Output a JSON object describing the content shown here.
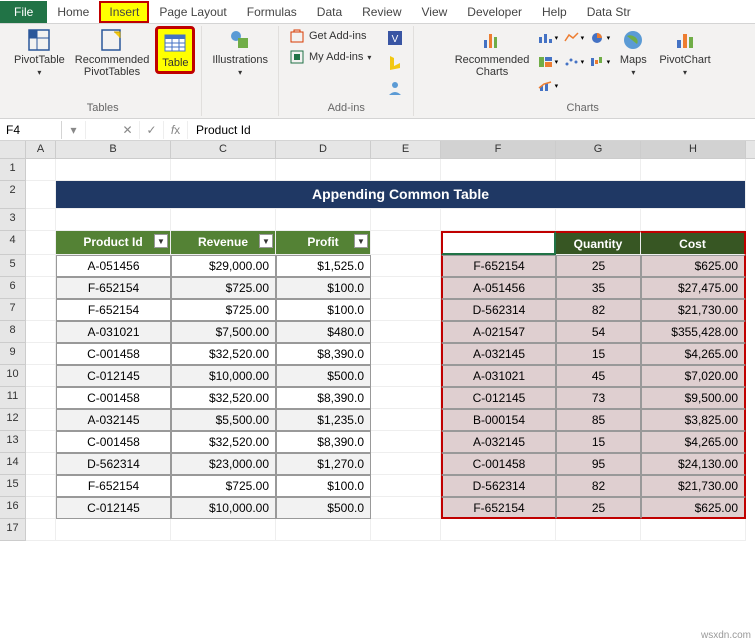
{
  "tabs": {
    "file": "File",
    "home": "Home",
    "insert": "Insert",
    "pagelayout": "Page Layout",
    "formulas": "Formulas",
    "data": "Data",
    "review": "Review",
    "view": "View",
    "developer": "Developer",
    "help": "Help",
    "datastr": "Data Str"
  },
  "ribbon": {
    "tables": {
      "pivottable": "PivotTable",
      "recommended": "Recommended\nPivotTables",
      "table": "Table",
      "group": "Tables"
    },
    "illustrations": {
      "label": "Illustrations",
      "group": ""
    },
    "addins": {
      "getaddins": "Get Add-ins",
      "myaddins": "My Add-ins",
      "group": "Add-ins"
    },
    "charts": {
      "recommended": "Recommended\nCharts",
      "maps": "Maps",
      "pivotchart": "PivotChart",
      "group": "Charts"
    }
  },
  "formula_bar": {
    "name": "F4",
    "value": "Product Id"
  },
  "columns": {
    "A": 30,
    "B": 115,
    "C": 105,
    "D": 95,
    "E": 70,
    "F": 115,
    "G": 85,
    "H": 105
  },
  "title": "Appending Common Table",
  "left_table": {
    "headers": [
      "Product Id",
      "Revenue",
      "Profit"
    ],
    "rows": [
      [
        "A-051456",
        "$29,000.00",
        "$1,525.0"
      ],
      [
        "F-652154",
        "$725.00",
        "$100.0"
      ],
      [
        "F-652154",
        "$725.00",
        "$100.0"
      ],
      [
        "A-031021",
        "$7,500.00",
        "$480.0"
      ],
      [
        "C-001458",
        "$32,520.00",
        "$8,390.0"
      ],
      [
        "C-012145",
        "$10,000.00",
        "$500.0"
      ],
      [
        "C-001458",
        "$32,520.00",
        "$8,390.0"
      ],
      [
        "A-032145",
        "$5,500.00",
        "$1,235.0"
      ],
      [
        "C-001458",
        "$32,520.00",
        "$8,390.0"
      ],
      [
        "D-562314",
        "$23,000.00",
        "$1,270.0"
      ],
      [
        "F-652154",
        "$725.00",
        "$100.0"
      ],
      [
        "C-012145",
        "$10,000.00",
        "$500.0"
      ]
    ]
  },
  "right_table": {
    "headers": [
      "Product Id",
      "Quantity",
      "Cost"
    ],
    "rows": [
      [
        "F-652154",
        "25",
        "$625.00"
      ],
      [
        "A-051456",
        "35",
        "$27,475.00"
      ],
      [
        "D-562314",
        "82",
        "$21,730.00"
      ],
      [
        "A-021547",
        "54",
        "$355,428.00"
      ],
      [
        "A-032145",
        "15",
        "$4,265.00"
      ],
      [
        "A-031021",
        "45",
        "$7,020.00"
      ],
      [
        "C-012145",
        "73",
        "$9,500.00"
      ],
      [
        "B-000154",
        "85",
        "$3,825.00"
      ],
      [
        "A-032145",
        "15",
        "$4,265.00"
      ],
      [
        "C-001458",
        "95",
        "$24,130.00"
      ],
      [
        "D-562314",
        "82",
        "$21,730.00"
      ],
      [
        "F-652154",
        "25",
        "$625.00"
      ]
    ]
  },
  "watermark": "wsxdn.com"
}
